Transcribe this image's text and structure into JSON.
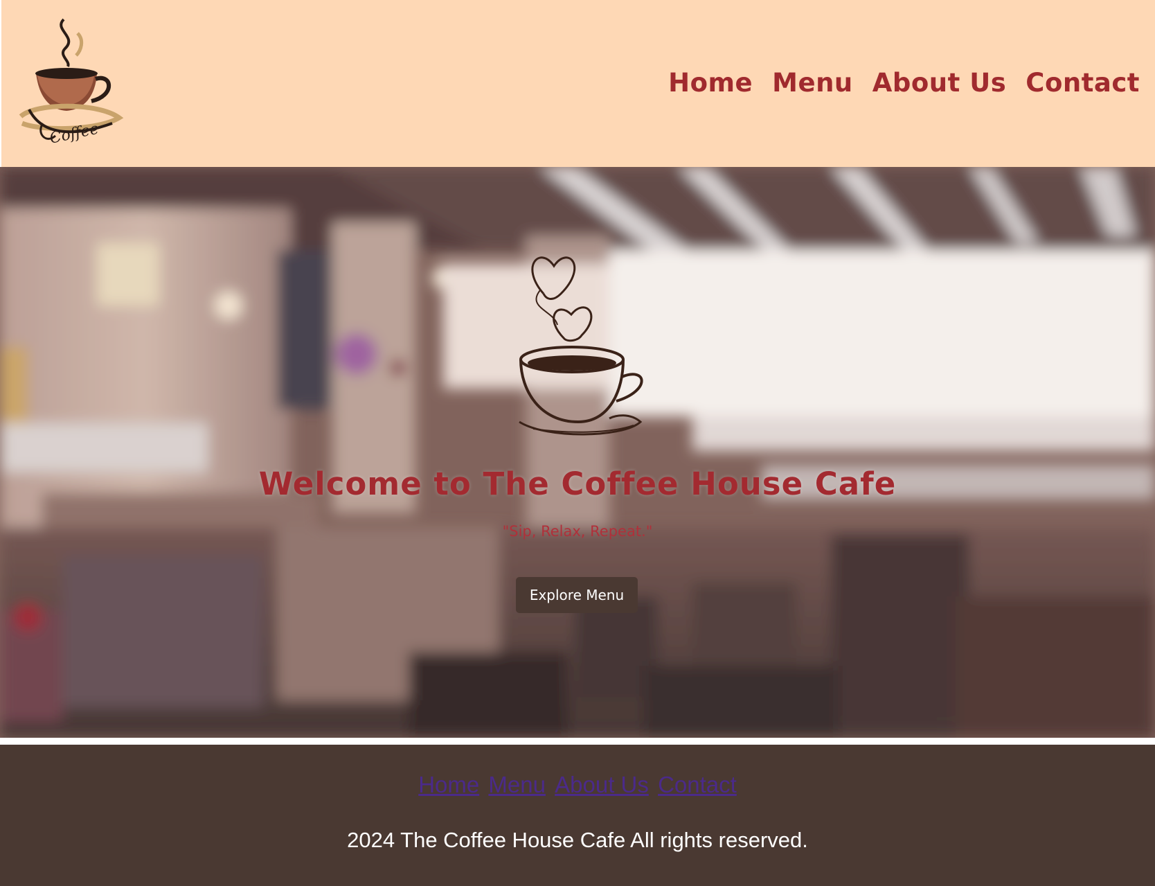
{
  "header": {
    "logo_text": "Coffee",
    "nav": [
      {
        "label": "Home"
      },
      {
        "label": "Menu"
      },
      {
        "label": "About Us"
      },
      {
        "label": "Contact"
      }
    ]
  },
  "hero": {
    "title": "Welcome to The Coffee House Cafe",
    "tagline": "\"Sip, Relax, Repeat.\"",
    "button_label": "Explore Menu"
  },
  "footer": {
    "nav": [
      {
        "label": "Home"
      },
      {
        "label": "Menu"
      },
      {
        "label": "About Us"
      },
      {
        "label": "Contact"
      }
    ],
    "copyright": "2024 The Coffee House Cafe All rights reserved."
  },
  "colors": {
    "header_bg": "#fed8b5",
    "nav_text": "#a02a2e",
    "footer_bg": "#4a3932",
    "button_bg": "#4a3932",
    "footer_link": "#4b2a8a"
  }
}
